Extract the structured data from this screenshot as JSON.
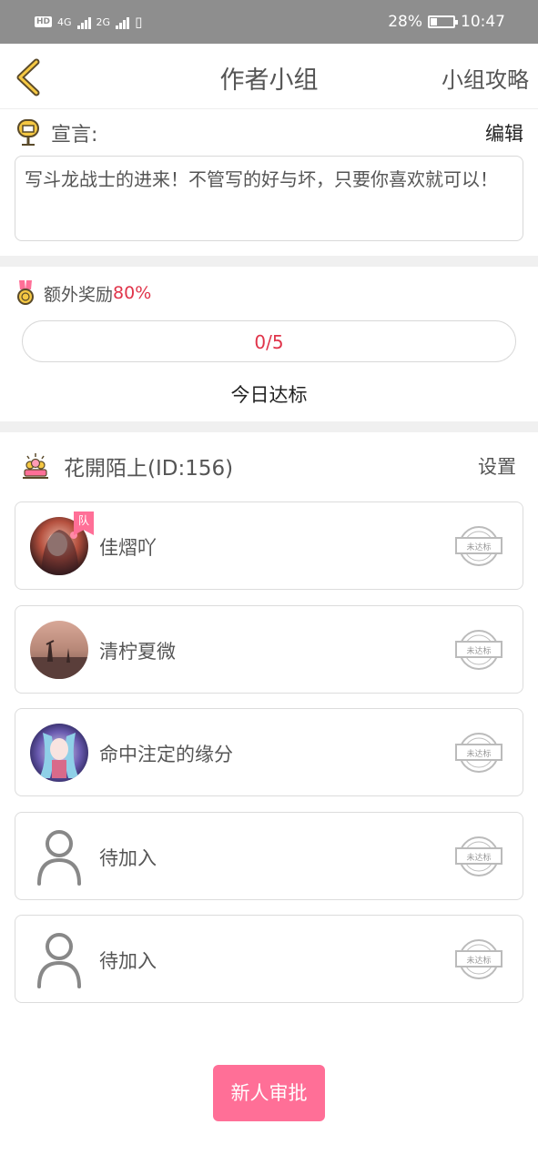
{
  "status_bar": {
    "network_1": "4G",
    "network_2": "2G",
    "battery_percent": "28%",
    "battery_level": 0.28,
    "time": "10:47"
  },
  "nav": {
    "title": "作者小组",
    "strategy_link": "小组攻略"
  },
  "manifesto": {
    "label": "宣言:",
    "edit_label": "编辑",
    "text": "写斗龙战士的进来！不管写的好与坏，只要你喜欢就可以！"
  },
  "reward": {
    "label": "额外奖励",
    "percent": "80%"
  },
  "progress": {
    "text": "0/5",
    "current": 0,
    "target": 5,
    "caption": "今日达标"
  },
  "group": {
    "name": "花開陌上(ID:156)",
    "settings_label": "设置"
  },
  "members": [
    {
      "name": "佳熠吖",
      "leader_badge": "队",
      "stamp": "未达标"
    },
    {
      "name": "清柠夏微",
      "stamp": "未达标"
    },
    {
      "name": "命中注定的缘分",
      "stamp": "未达标"
    },
    {
      "name": "待加入",
      "stamp": "未达标"
    },
    {
      "name": "待加入",
      "stamp": "未达标"
    }
  ],
  "approve_button": "新人审批",
  "colors": {
    "accent_pink": "#ff6f97",
    "alert_red": "#e0344a",
    "status_bar": "#8e8e8e"
  }
}
